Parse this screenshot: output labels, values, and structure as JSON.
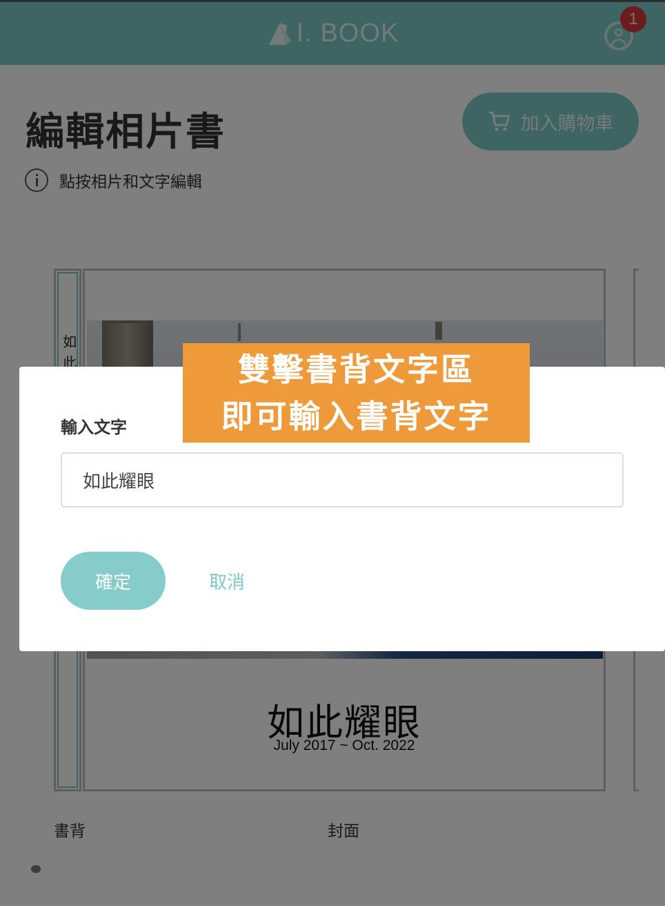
{
  "header": {
    "logo_text": "I. BOOK",
    "notification_count": "1"
  },
  "main": {
    "title": "編輯相片書",
    "cart_button_label": "加入購物車",
    "hint_text": "點按相片和文字編輯"
  },
  "book": {
    "spine_text": "如此",
    "cover_title": "如此耀眼",
    "cover_date": "July 2017 ~ Oct. 2022",
    "spine_label": "書背",
    "cover_label": "封面"
  },
  "dialog": {
    "label": "輸入文字",
    "input_value": "如此耀眼",
    "confirm_label": "確定",
    "cancel_label": "取消"
  },
  "callout": {
    "line1": "雙擊書背文字區",
    "line2": "即可輸入書背文字"
  },
  "colors": {
    "accent": "#7cc9c9",
    "badge": "#d9393a",
    "callout": "#ef9a3a"
  }
}
